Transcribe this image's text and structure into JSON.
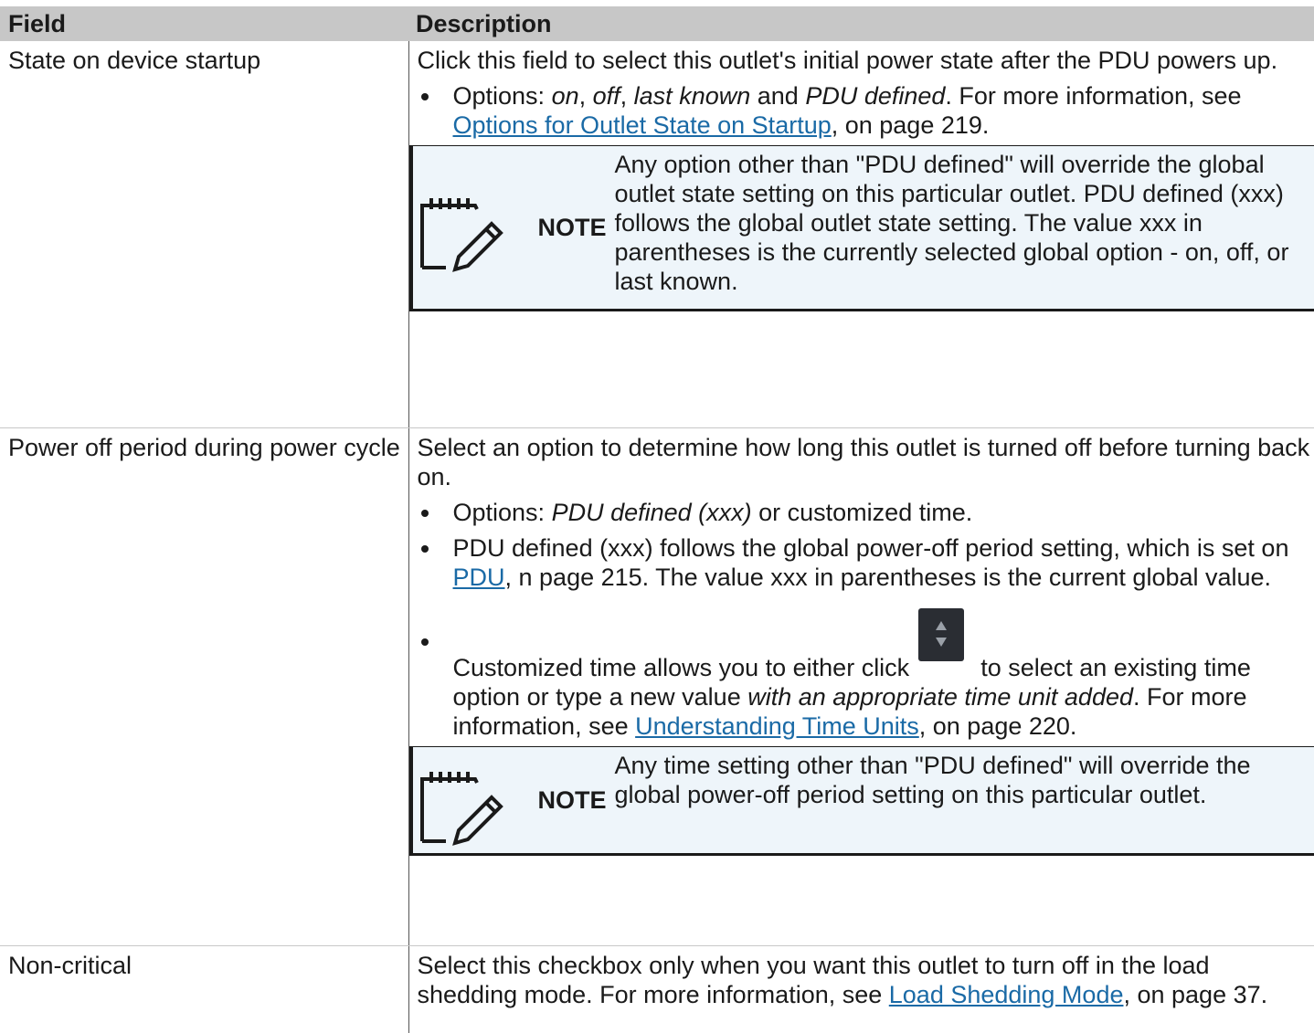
{
  "table": {
    "headers": {
      "field": "Field",
      "description": "Description"
    },
    "rows": [
      {
        "field": "State on device startup",
        "intro": "Click this field to select this outlet's initial power state after the PDU powers up.",
        "bullet1": {
          "pre": "Options: ",
          "opt_on": "on",
          "sep1": ", ",
          "opt_off": "off",
          "sep2": ", ",
          "opt_last": "last known",
          "sep3": " and ",
          "opt_pdu": "PDU defined",
          "mid": ". For more information, see ",
          "link": "Options for Outlet State on Startup",
          "post": ", on page 219."
        },
        "note": {
          "label": "NOTE",
          "text": "Any option other than \"PDU defined\" will override the global outlet state setting on this particular outlet. PDU defined (xxx) follows the global outlet state setting. The value xxx in parentheses is the currently selected global option - on, off, or last known."
        }
      },
      {
        "field": "Power off period during power cycle",
        "intro": "Select an option to determine how long this outlet is turned off before turning back on.",
        "bullet1": {
          "pre": "Options: ",
          "em": "PDU defined (xxx)",
          "post": " or customized time."
        },
        "bullet2": {
          "pre": "PDU defined (xxx) follows the global power-off period setting, which is set on ",
          "link": "PDU",
          "post": ", n page 215. The value xxx in parentheses is the current global value."
        },
        "bullet3": {
          "pre": "Customized time allows you to either click",
          "icon": "spinner-arrows-icon",
          "mid": "to select an existing time option or type a new value ",
          "em": "with an appropriate time unit added",
          "mid2": ". For more information, see ",
          "link": "Understanding Time Units",
          "post": ", on page 220."
        },
        "note": {
          "label": "NOTE",
          "text": "Any time setting other than \"PDU defined\" will override the global power-off period setting on this particular outlet."
        }
      },
      {
        "field": "Non-critical",
        "intro_pre": "Select this checkbox only when you want this outlet to turn off in the load shedding mode. For more information, see ",
        "link": "Load Shedding Mode",
        "post": ", on page 37."
      }
    ]
  },
  "icons": {
    "note": "notepad-pencil-icon"
  },
  "colors": {
    "header_bg": "#c7c7c7",
    "link": "#1a6aa6",
    "note_bg": "#eef5fa"
  }
}
